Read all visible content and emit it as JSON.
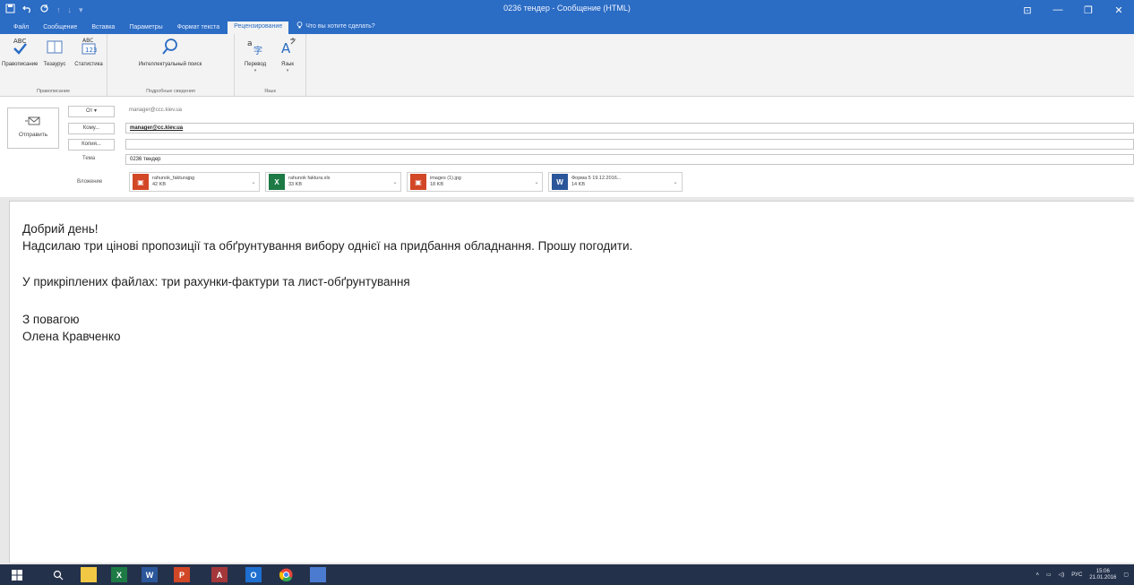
{
  "window": {
    "title": "0236 тендер  -  Сообщение (HTML)",
    "qat": {
      "save_icon": "save-icon",
      "undo_icon": "undo-icon",
      "redo_icon": "redo-icon"
    },
    "controls": {
      "ribbon_options": "⊡",
      "minimize": "—",
      "restore": "❐",
      "close": "✕"
    }
  },
  "tabs": [
    {
      "label": "Файл"
    },
    {
      "label": "Сообщение"
    },
    {
      "label": "Вставка"
    },
    {
      "label": "Параметры"
    },
    {
      "label": "Формат текста"
    },
    {
      "label": "Рецензирование",
      "active": true
    },
    {
      "label": "Что вы хотите сделать?"
    }
  ],
  "ribbon": {
    "groups": [
      {
        "label": "Правописание",
        "buttons": [
          {
            "label": "Правописание"
          },
          {
            "label": "Тезаурус"
          },
          {
            "label": "Статистика"
          }
        ]
      },
      {
        "label": "Подробные сведения",
        "buttons": [
          {
            "label": "Интеллектуальный поиск"
          }
        ]
      },
      {
        "label": "Язык",
        "buttons": [
          {
            "label": "Перевод"
          },
          {
            "label": "Язык"
          }
        ]
      }
    ]
  },
  "header": {
    "send_label": "Отправить",
    "from_label": "От ▾",
    "from_value": "manager@ccc.kiev.ua",
    "to_label": "Кому...",
    "to_value": "manager@cc.kiev.ua",
    "cc_label": "Копия...",
    "cc_value": "",
    "subject_label": "Тема",
    "subject_value": "0236 тендер",
    "attached_label": "Вложение",
    "attachments": [
      {
        "name": "rahunok_fakturajpg",
        "size": "42 KB",
        "type": "image",
        "color": "#d24726"
      },
      {
        "name": "rahunok faktura.xls",
        "size": "33 KB",
        "type": "excel",
        "color": "#1d7a45"
      },
      {
        "name": "images (1).jpg",
        "size": "18 KB",
        "type": "image",
        "color": "#d24726"
      },
      {
        "name": "Форма 5   19.12.2016...",
        "size": "14 KB",
        "type": "word",
        "color": "#2b579a"
      }
    ]
  },
  "body": {
    "greeting": "Добрий день!",
    "line1": "Надсилаю три цінові пропозиції та обґрунтування вибору однієї на придбання обладнання. Прошу погодити.",
    "line2": "У прикріплених файлах: три рахунки-фактури та лист-обґрунтування",
    "regards": "З повагою",
    "signature": "Олена Кравченко"
  },
  "taskbar": {
    "items": [
      {
        "name": "start",
        "glyph": "⊞",
        "color": "#ffffff"
      },
      {
        "name": "search",
        "glyph": "⌕",
        "color": "#ffffff"
      },
      {
        "name": "file-explorer",
        "glyph": "▬",
        "color": "#f2c744"
      },
      {
        "name": "excel",
        "glyph": "X",
        "color": "#1d7a45"
      },
      {
        "name": "word",
        "glyph": "W",
        "color": "#2b579a"
      },
      {
        "name": "powerpoint",
        "glyph": "P",
        "color": "#d24726"
      },
      {
        "name": "access",
        "glyph": "A",
        "color": "#a4373a"
      },
      {
        "name": "outlook",
        "glyph": "O",
        "color": "#1f6fd1"
      },
      {
        "name": "chrome",
        "glyph": "●",
        "color": "#e8453c"
      },
      {
        "name": "app",
        "glyph": "▦",
        "color": "#4a7bd1"
      }
    ],
    "tray": {
      "lang": "РУС",
      "time": "15:06",
      "date": "21.01.2016"
    }
  }
}
